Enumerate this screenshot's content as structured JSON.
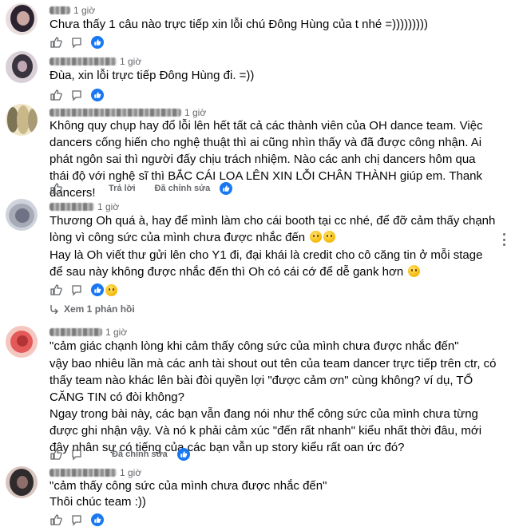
{
  "comments": [
    {
      "time": "1 giờ",
      "text": "Chưa thấy 1 câu nào trực tiếp xin lỗi chú Đông Hùng của t nhé =)))))))))",
      "actions": {
        "reply": "",
        "edited": ""
      },
      "colors": [
        "#2b2430",
        "#e9dedd",
        "#7a5a63"
      ]
    },
    {
      "time": "1 giờ",
      "text": "Đùa, xin lỗi trực tiếp Đông Hùng đi. =))",
      "actions": {
        "reply": "",
        "edited": ""
      },
      "colors": [
        "#3a3340",
        "#d9cfd6",
        "#8c7c88"
      ]
    },
    {
      "time": "1 giờ",
      "text": "Không quy chụp hay đổ lỗi lên hết tất cả các thành viên của OH dance team. Việc dancers cống hiến cho nghệ thuật thì ai cũng nhìn thấy và đã được công nhận. Ai phát ngôn sai thì người đấy chịu trách nhiệm. Nào các anh chị dancers hôm qua thái độ với nghệ sĩ thì BẮC CÁI LOA LÊN XIN LỖI CHÂN THÀNH giúp em. Thank dancers!",
      "actions": {
        "reply": "Trả lời",
        "edited": "Đã chỉnh sửa"
      },
      "colors": [
        "#c9b98a",
        "#7d7355",
        "#efe6c8"
      ]
    },
    {
      "time": "1 giờ",
      "text": "Thương Oh quá à, hay để mình làm cho cái booth tại cc nhé, để đỡ cảm thấy chạnh lòng vì công sức của mình chưa được nhắc đến",
      "text2": "Hay là Oh viết thư gửi lên cho Y1 đi, đại khái là credit cho cô căng tin ở mỗi stage để sau này không được nhắc đến thì Oh có cái cớ để dễ gank hơn",
      "actions": {
        "reply": "",
        "edited": ""
      },
      "view_replies": "Xem 1 phản hồi",
      "colors": [
        "#cfd3dc",
        "#6d7384",
        "#a7abb8"
      ]
    },
    {
      "time": "1 giờ",
      "text": "\"cảm giác chạnh lòng khi cảm thấy công sức của mình chưa được nhắc đến\"",
      "text2": "vậy bao nhiêu lần mà các anh tài shout out tên của team dancer trực tiếp trên ctr, có thấy team nào khác lên bài đòi quyền lợi \"được cảm ơn\" cùng không? ví dụ, TỔ CĂNG TIN có đòi không?",
      "text3": "Ngay trong bài này, các bạn vẫn đang nói như thể công sức của mình chưa từng được ghi nhận vậy. Và nó k phải cảm xúc \"đến rất nhanh\" kiểu nhất thời đâu, mới đây nhân sự có tiếng của các bạn vẫn up story kiểu rất oan ức đó?",
      "actions": {
        "reply": "",
        "edited": "Đã chỉnh sửa"
      },
      "colors": [
        "#e45a5a",
        "#f4c7c0",
        "#b33434"
      ]
    },
    {
      "time": "1 giờ",
      "text": "\"cảm thấy công sức của mình chưa được nhắc đến\"",
      "text2": "Thôi chúc team :))",
      "actions": {
        "reply": "",
        "edited": ""
      },
      "colors": [
        "#2f2a2c",
        "#d8c5c0",
        "#8d6e6a"
      ]
    }
  ]
}
